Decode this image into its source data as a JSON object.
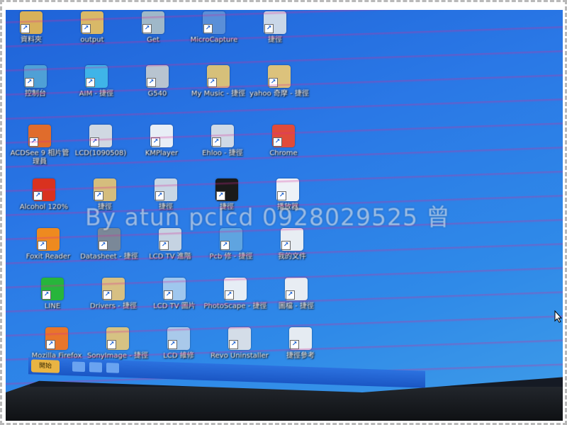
{
  "photo": {
    "watermark": "By atun pclcd 0928029525 曾"
  },
  "desktop": {
    "icons": [
      {
        "label": "資料夾",
        "icon": "folder-icon",
        "color": "#d7b15a"
      },
      {
        "label": "output",
        "icon": "folder-icon",
        "color": "#d9b968"
      },
      {
        "label": "Get",
        "icon": "app-icon",
        "color": "#9fb8c9"
      },
      {
        "label": "MicroCapture",
        "icon": "shortcut-icon",
        "color": "#5a8fd8"
      },
      {
        "label": "捷徑",
        "icon": "shortcut-icon",
        "color": "#c9d7e8"
      },
      {
        "label": "控制台",
        "icon": "control-panel-icon",
        "color": "#4fa0d6"
      },
      {
        "label": "AIM - 捷徑",
        "icon": "aim-icon",
        "color": "#3fb4e8"
      },
      {
        "label": "G540",
        "icon": "printer-icon",
        "color": "#b8c4d0"
      },
      {
        "label": "My Music - 捷徑",
        "icon": "folder-icon",
        "color": "#d6c07a"
      },
      {
        "label": "yahoo 奇摩 - 捷徑",
        "icon": "folder-icon",
        "color": "#dcc27c"
      },
      {
        "label": "ACDSee 9 相片管理員",
        "icon": "acdsee-icon",
        "color": "#e06c2c"
      },
      {
        "label": "LCD(1090508)",
        "icon": "document-icon",
        "color": "#d0d8e2"
      },
      {
        "label": "KMPlayer",
        "icon": "kmplayer-icon",
        "color": "#e8eef6"
      },
      {
        "label": "Ehloo - 捷徑",
        "icon": "app-icon",
        "color": "#cfd9e6"
      },
      {
        "label": "Chrome",
        "icon": "chrome-icon",
        "color": "#e04b3a"
      },
      {
        "label": "Alcohol 120%",
        "icon": "alcohol-icon",
        "color": "#d9321f"
      },
      {
        "label": "捷徑",
        "icon": "folder-icon",
        "color": "#d5bd7d"
      },
      {
        "label": "捷徑",
        "icon": "document-icon",
        "color": "#c8d6e4"
      },
      {
        "label": "捷徑",
        "icon": "app-icon",
        "color": "#1a1a1a"
      },
      {
        "label": "播放器",
        "icon": "document-icon",
        "color": "#eef2f7"
      },
      {
        "label": "Foxit Reader",
        "icon": "foxit-icon",
        "color": "#ee8a1f"
      },
      {
        "label": "Datasheet - 捷徑",
        "icon": "app-icon",
        "color": "#7a8898"
      },
      {
        "label": "LCD TV 進階",
        "icon": "tool-icon",
        "color": "#c5d3e2"
      },
      {
        "label": "Pcb 修 - 捷徑",
        "icon": "network-icon",
        "color": "#5fa4e0"
      },
      {
        "label": "我的文件",
        "icon": "documents-icon",
        "color": "#e8edf3"
      },
      {
        "label": "LINE",
        "icon": "line-icon",
        "color": "#27b53b"
      },
      {
        "label": "Drivers - 捷徑",
        "icon": "folder-icon",
        "color": "#d7c083"
      },
      {
        "label": "LCD TV 圖片",
        "icon": "image-icon",
        "color": "#9fc7ee"
      },
      {
        "label": "PhotoScape - 捷徑",
        "icon": "photoscape-icon",
        "color": "#e6edf5"
      },
      {
        "label": "圖檔 - 捷徑",
        "icon": "document-icon",
        "color": "#e8edf3"
      },
      {
        "label": "Mozilla Firefox",
        "icon": "firefox-icon",
        "color": "#e8762a"
      },
      {
        "label": "SonyImage - 捷徑",
        "icon": "folder-icon",
        "color": "#d6c283"
      },
      {
        "label": "LCD 維修",
        "icon": "monitor-icon",
        "color": "#a9c9ea"
      },
      {
        "label": "Revo Uninstaller",
        "icon": "uninstaller-icon",
        "color": "#d4dde8"
      },
      {
        "label": "捷徑參考",
        "icon": "document-icon",
        "color": "#e5ebf2"
      }
    ]
  },
  "taskbar": {
    "start_label": "開始"
  }
}
